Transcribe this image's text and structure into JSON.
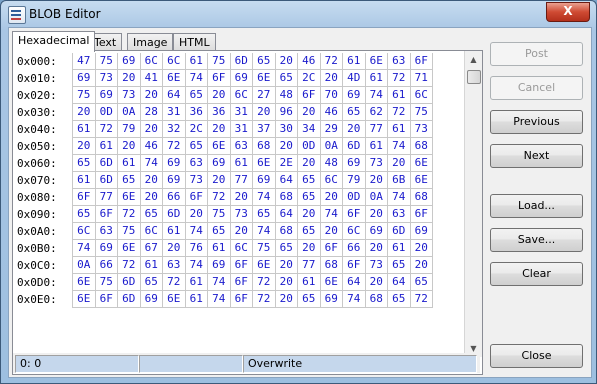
{
  "window": {
    "title": "BLOB Editor",
    "close_label": "X"
  },
  "tabs": [
    {
      "label": "Hexadecimal",
      "active": true
    },
    {
      "label": "Text",
      "active": false
    },
    {
      "label": "Image",
      "active": false
    },
    {
      "label": "HTML",
      "active": false
    }
  ],
  "hex": {
    "rows": [
      {
        "address": "0x000:",
        "bytes": [
          "47",
          "75",
          "69",
          "6C",
          "6C",
          "61",
          "75",
          "6D",
          "65",
          "20",
          "46",
          "72",
          "61",
          "6E",
          "63",
          "6F"
        ]
      },
      {
        "address": "0x010:",
        "bytes": [
          "69",
          "73",
          "20",
          "41",
          "6E",
          "74",
          "6F",
          "69",
          "6E",
          "65",
          "2C",
          "20",
          "4D",
          "61",
          "72",
          "71"
        ]
      },
      {
        "address": "0x020:",
        "bytes": [
          "75",
          "69",
          "73",
          "20",
          "64",
          "65",
          "20",
          "6C",
          "27",
          "48",
          "6F",
          "70",
          "69",
          "74",
          "61",
          "6C"
        ]
      },
      {
        "address": "0x030:",
        "bytes": [
          "20",
          "0D",
          "0A",
          "28",
          "31",
          "36",
          "36",
          "31",
          "20",
          "96",
          "20",
          "46",
          "65",
          "62",
          "72",
          "75"
        ]
      },
      {
        "address": "0x040:",
        "bytes": [
          "61",
          "72",
          "79",
          "20",
          "32",
          "2C",
          "20",
          "31",
          "37",
          "30",
          "34",
          "29",
          "20",
          "77",
          "61",
          "73"
        ]
      },
      {
        "address": "0x050:",
        "bytes": [
          "20",
          "61",
          "20",
          "46",
          "72",
          "65",
          "6E",
          "63",
          "68",
          "20",
          "0D",
          "0A",
          "6D",
          "61",
          "74",
          "68"
        ]
      },
      {
        "address": "0x060:",
        "bytes": [
          "65",
          "6D",
          "61",
          "74",
          "69",
          "63",
          "69",
          "61",
          "6E",
          "2E",
          "20",
          "48",
          "69",
          "73",
          "20",
          "6E"
        ]
      },
      {
        "address": "0x070:",
        "bytes": [
          "61",
          "6D",
          "65",
          "20",
          "69",
          "73",
          "20",
          "77",
          "69",
          "64",
          "65",
          "6C",
          "79",
          "20",
          "6B",
          "6E"
        ]
      },
      {
        "address": "0x080:",
        "bytes": [
          "6F",
          "77",
          "6E",
          "20",
          "66",
          "6F",
          "72",
          "20",
          "74",
          "68",
          "65",
          "20",
          "0D",
          "0A",
          "74",
          "68"
        ]
      },
      {
        "address": "0x090:",
        "bytes": [
          "65",
          "6F",
          "72",
          "65",
          "6D",
          "20",
          "75",
          "73",
          "65",
          "64",
          "20",
          "74",
          "6F",
          "20",
          "63",
          "6F"
        ]
      },
      {
        "address": "0x0A0:",
        "bytes": [
          "6C",
          "63",
          "75",
          "6C",
          "61",
          "74",
          "65",
          "20",
          "74",
          "68",
          "65",
          "20",
          "6C",
          "69",
          "6D",
          "69"
        ]
      },
      {
        "address": "0x0B0:",
        "bytes": [
          "74",
          "69",
          "6E",
          "67",
          "20",
          "76",
          "61",
          "6C",
          "75",
          "65",
          "20",
          "6F",
          "66",
          "20",
          "61",
          "20"
        ]
      },
      {
        "address": "0x0C0:",
        "bytes": [
          "0A",
          "66",
          "72",
          "61",
          "63",
          "74",
          "69",
          "6F",
          "6E",
          "20",
          "77",
          "68",
          "6F",
          "73",
          "65",
          "20"
        ]
      },
      {
        "address": "0x0D0:",
        "bytes": [
          "6E",
          "75",
          "6D",
          "65",
          "72",
          "61",
          "74",
          "6F",
          "72",
          "20",
          "61",
          "6E",
          "64",
          "20",
          "64",
          "65"
        ]
      },
      {
        "address": "0x0E0:",
        "bytes": [
          "6E",
          "6F",
          "6D",
          "69",
          "6E",
          "61",
          "74",
          "6F",
          "72",
          "20",
          "65",
          "69",
          "74",
          "68",
          "65",
          "72"
        ]
      }
    ]
  },
  "status": {
    "position": "0: 0",
    "middle": "",
    "mode": "Overwrite"
  },
  "buttons": {
    "post": "Post",
    "cancel": "Cancel",
    "previous": "Previous",
    "next": "Next",
    "load": "Load...",
    "save": "Save...",
    "clear": "Clear",
    "close": "Close"
  },
  "colors": {
    "hex_text": "#1a1acc",
    "grid_line": "#c8c8c8",
    "status_bg": "#c5d7ec"
  }
}
